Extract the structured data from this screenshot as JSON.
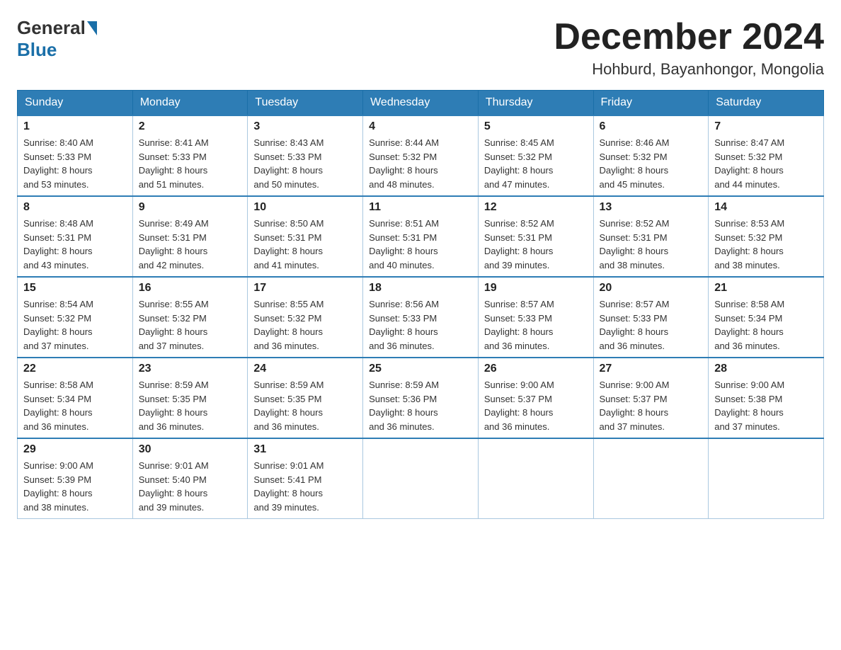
{
  "header": {
    "logo_general": "General",
    "logo_blue": "Blue",
    "month_title": "December 2024",
    "location": "Hohburd, Bayanhongor, Mongolia"
  },
  "weekdays": [
    "Sunday",
    "Monday",
    "Tuesday",
    "Wednesday",
    "Thursday",
    "Friday",
    "Saturday"
  ],
  "weeks": [
    [
      {
        "day": "1",
        "sunrise": "8:40 AM",
        "sunset": "5:33 PM",
        "daylight": "8 hours and 53 minutes."
      },
      {
        "day": "2",
        "sunrise": "8:41 AM",
        "sunset": "5:33 PM",
        "daylight": "8 hours and 51 minutes."
      },
      {
        "day": "3",
        "sunrise": "8:43 AM",
        "sunset": "5:33 PM",
        "daylight": "8 hours and 50 minutes."
      },
      {
        "day": "4",
        "sunrise": "8:44 AM",
        "sunset": "5:32 PM",
        "daylight": "8 hours and 48 minutes."
      },
      {
        "day": "5",
        "sunrise": "8:45 AM",
        "sunset": "5:32 PM",
        "daylight": "8 hours and 47 minutes."
      },
      {
        "day": "6",
        "sunrise": "8:46 AM",
        "sunset": "5:32 PM",
        "daylight": "8 hours and 45 minutes."
      },
      {
        "day": "7",
        "sunrise": "8:47 AM",
        "sunset": "5:32 PM",
        "daylight": "8 hours and 44 minutes."
      }
    ],
    [
      {
        "day": "8",
        "sunrise": "8:48 AM",
        "sunset": "5:31 PM",
        "daylight": "8 hours and 43 minutes."
      },
      {
        "day": "9",
        "sunrise": "8:49 AM",
        "sunset": "5:31 PM",
        "daylight": "8 hours and 42 minutes."
      },
      {
        "day": "10",
        "sunrise": "8:50 AM",
        "sunset": "5:31 PM",
        "daylight": "8 hours and 41 minutes."
      },
      {
        "day": "11",
        "sunrise": "8:51 AM",
        "sunset": "5:31 PM",
        "daylight": "8 hours and 40 minutes."
      },
      {
        "day": "12",
        "sunrise": "8:52 AM",
        "sunset": "5:31 PM",
        "daylight": "8 hours and 39 minutes."
      },
      {
        "day": "13",
        "sunrise": "8:52 AM",
        "sunset": "5:31 PM",
        "daylight": "8 hours and 38 minutes."
      },
      {
        "day": "14",
        "sunrise": "8:53 AM",
        "sunset": "5:32 PM",
        "daylight": "8 hours and 38 minutes."
      }
    ],
    [
      {
        "day": "15",
        "sunrise": "8:54 AM",
        "sunset": "5:32 PM",
        "daylight": "8 hours and 37 minutes."
      },
      {
        "day": "16",
        "sunrise": "8:55 AM",
        "sunset": "5:32 PM",
        "daylight": "8 hours and 37 minutes."
      },
      {
        "day": "17",
        "sunrise": "8:55 AM",
        "sunset": "5:32 PM",
        "daylight": "8 hours and 36 minutes."
      },
      {
        "day": "18",
        "sunrise": "8:56 AM",
        "sunset": "5:33 PM",
        "daylight": "8 hours and 36 minutes."
      },
      {
        "day": "19",
        "sunrise": "8:57 AM",
        "sunset": "5:33 PM",
        "daylight": "8 hours and 36 minutes."
      },
      {
        "day": "20",
        "sunrise": "8:57 AM",
        "sunset": "5:33 PM",
        "daylight": "8 hours and 36 minutes."
      },
      {
        "day": "21",
        "sunrise": "8:58 AM",
        "sunset": "5:34 PM",
        "daylight": "8 hours and 36 minutes."
      }
    ],
    [
      {
        "day": "22",
        "sunrise": "8:58 AM",
        "sunset": "5:34 PM",
        "daylight": "8 hours and 36 minutes."
      },
      {
        "day": "23",
        "sunrise": "8:59 AM",
        "sunset": "5:35 PM",
        "daylight": "8 hours and 36 minutes."
      },
      {
        "day": "24",
        "sunrise": "8:59 AM",
        "sunset": "5:35 PM",
        "daylight": "8 hours and 36 minutes."
      },
      {
        "day": "25",
        "sunrise": "8:59 AM",
        "sunset": "5:36 PM",
        "daylight": "8 hours and 36 minutes."
      },
      {
        "day": "26",
        "sunrise": "9:00 AM",
        "sunset": "5:37 PM",
        "daylight": "8 hours and 36 minutes."
      },
      {
        "day": "27",
        "sunrise": "9:00 AM",
        "sunset": "5:37 PM",
        "daylight": "8 hours and 37 minutes."
      },
      {
        "day": "28",
        "sunrise": "9:00 AM",
        "sunset": "5:38 PM",
        "daylight": "8 hours and 37 minutes."
      }
    ],
    [
      {
        "day": "29",
        "sunrise": "9:00 AM",
        "sunset": "5:39 PM",
        "daylight": "8 hours and 38 minutes."
      },
      {
        "day": "30",
        "sunrise": "9:01 AM",
        "sunset": "5:40 PM",
        "daylight": "8 hours and 39 minutes."
      },
      {
        "day": "31",
        "sunrise": "9:01 AM",
        "sunset": "5:41 PM",
        "daylight": "8 hours and 39 minutes."
      },
      null,
      null,
      null,
      null
    ]
  ],
  "labels": {
    "sunrise": "Sunrise:",
    "sunset": "Sunset:",
    "daylight": "Daylight:"
  }
}
